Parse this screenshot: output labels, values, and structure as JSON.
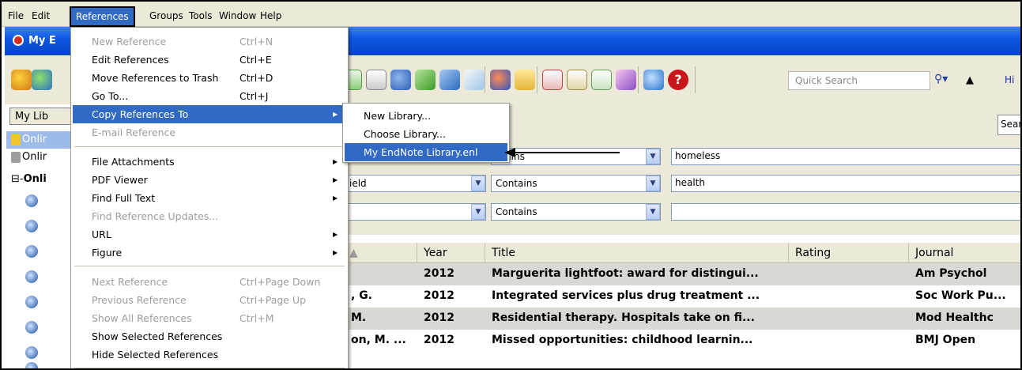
{
  "menubar": {
    "items": [
      "File",
      "Edit",
      "References",
      "Groups",
      "Tools",
      "Window",
      "Help"
    ]
  },
  "window": {
    "title": "My E"
  },
  "toolbar": {
    "quick_search_placeholder": "Quick Search",
    "hide_label": "Hi"
  },
  "left_panel": {
    "tab_label": "My Lib",
    "items": [
      "Onlir",
      "Onlir",
      "Onli"
    ]
  },
  "search_panel": {
    "search_button": "Sear",
    "rows": [
      {
        "field": "",
        "operator": "ntains",
        "term": "homeless"
      },
      {
        "field": "ield",
        "operator": "Contains",
        "term": "health"
      },
      {
        "field": "",
        "operator": "Contains",
        "term": ""
      }
    ]
  },
  "table": {
    "columns": [
      "Year",
      "Title",
      "Rating",
      "Journal"
    ],
    "rows": [
      {
        "author": "",
        "year": "2012",
        "title": "Marguerita lightfoot: award for distingui...",
        "rating": "",
        "journal": "Am Psychol"
      },
      {
        "author": ", G.",
        "year": "2012",
        "title": "Integrated services plus drug treatment ...",
        "rating": "",
        "journal": "Soc Work Pu..."
      },
      {
        "author": "M.",
        "year": "2012",
        "title": "Residential therapy. Hospitals take on fi...",
        "rating": "",
        "journal": "Mod Healthc"
      },
      {
        "author": "on, M. ...",
        "year": "2012",
        "title": "Missed opportunities: childhood learnin...",
        "rating": "",
        "journal": "BMJ Open"
      }
    ]
  },
  "references_menu": {
    "items": [
      {
        "label": "New Reference",
        "shortcut": "Ctrl+N",
        "disabled": true
      },
      {
        "label": "Edit References",
        "shortcut": "Ctrl+E"
      },
      {
        "label": "Move References to Trash",
        "shortcut": "Ctrl+D"
      },
      {
        "label": "Go To...",
        "shortcut": "Ctrl+J"
      },
      {
        "label": "Copy References To",
        "submenu": true,
        "highlighted": true
      },
      {
        "label": "E-mail Reference",
        "disabled": true
      },
      {
        "label": "File Attachments",
        "submenu": true
      },
      {
        "label": "PDF Viewer",
        "submenu": true
      },
      {
        "label": "Find Full Text",
        "submenu": true
      },
      {
        "label": "Find Reference Updates...",
        "disabled": true
      },
      {
        "label": "URL",
        "submenu": true
      },
      {
        "label": "Figure",
        "submenu": true
      },
      {
        "label": "Next Reference",
        "shortcut": "Ctrl+Page Down",
        "disabled": true
      },
      {
        "label": "Previous Reference",
        "shortcut": "Ctrl+Page Up",
        "disabled": true
      },
      {
        "label": "Show All References",
        "shortcut": "Ctrl+M",
        "disabled": true
      },
      {
        "label": "Show Selected References"
      },
      {
        "label": "Hide Selected References"
      }
    ]
  },
  "copy_submenu": {
    "items": [
      "New Library...",
      "Choose Library...",
      "My EndNote Library.enl"
    ]
  },
  "colors": {
    "highlight": "#316ac5",
    "titlebar": "#0a55e0",
    "menubar": "#ece9d8"
  }
}
